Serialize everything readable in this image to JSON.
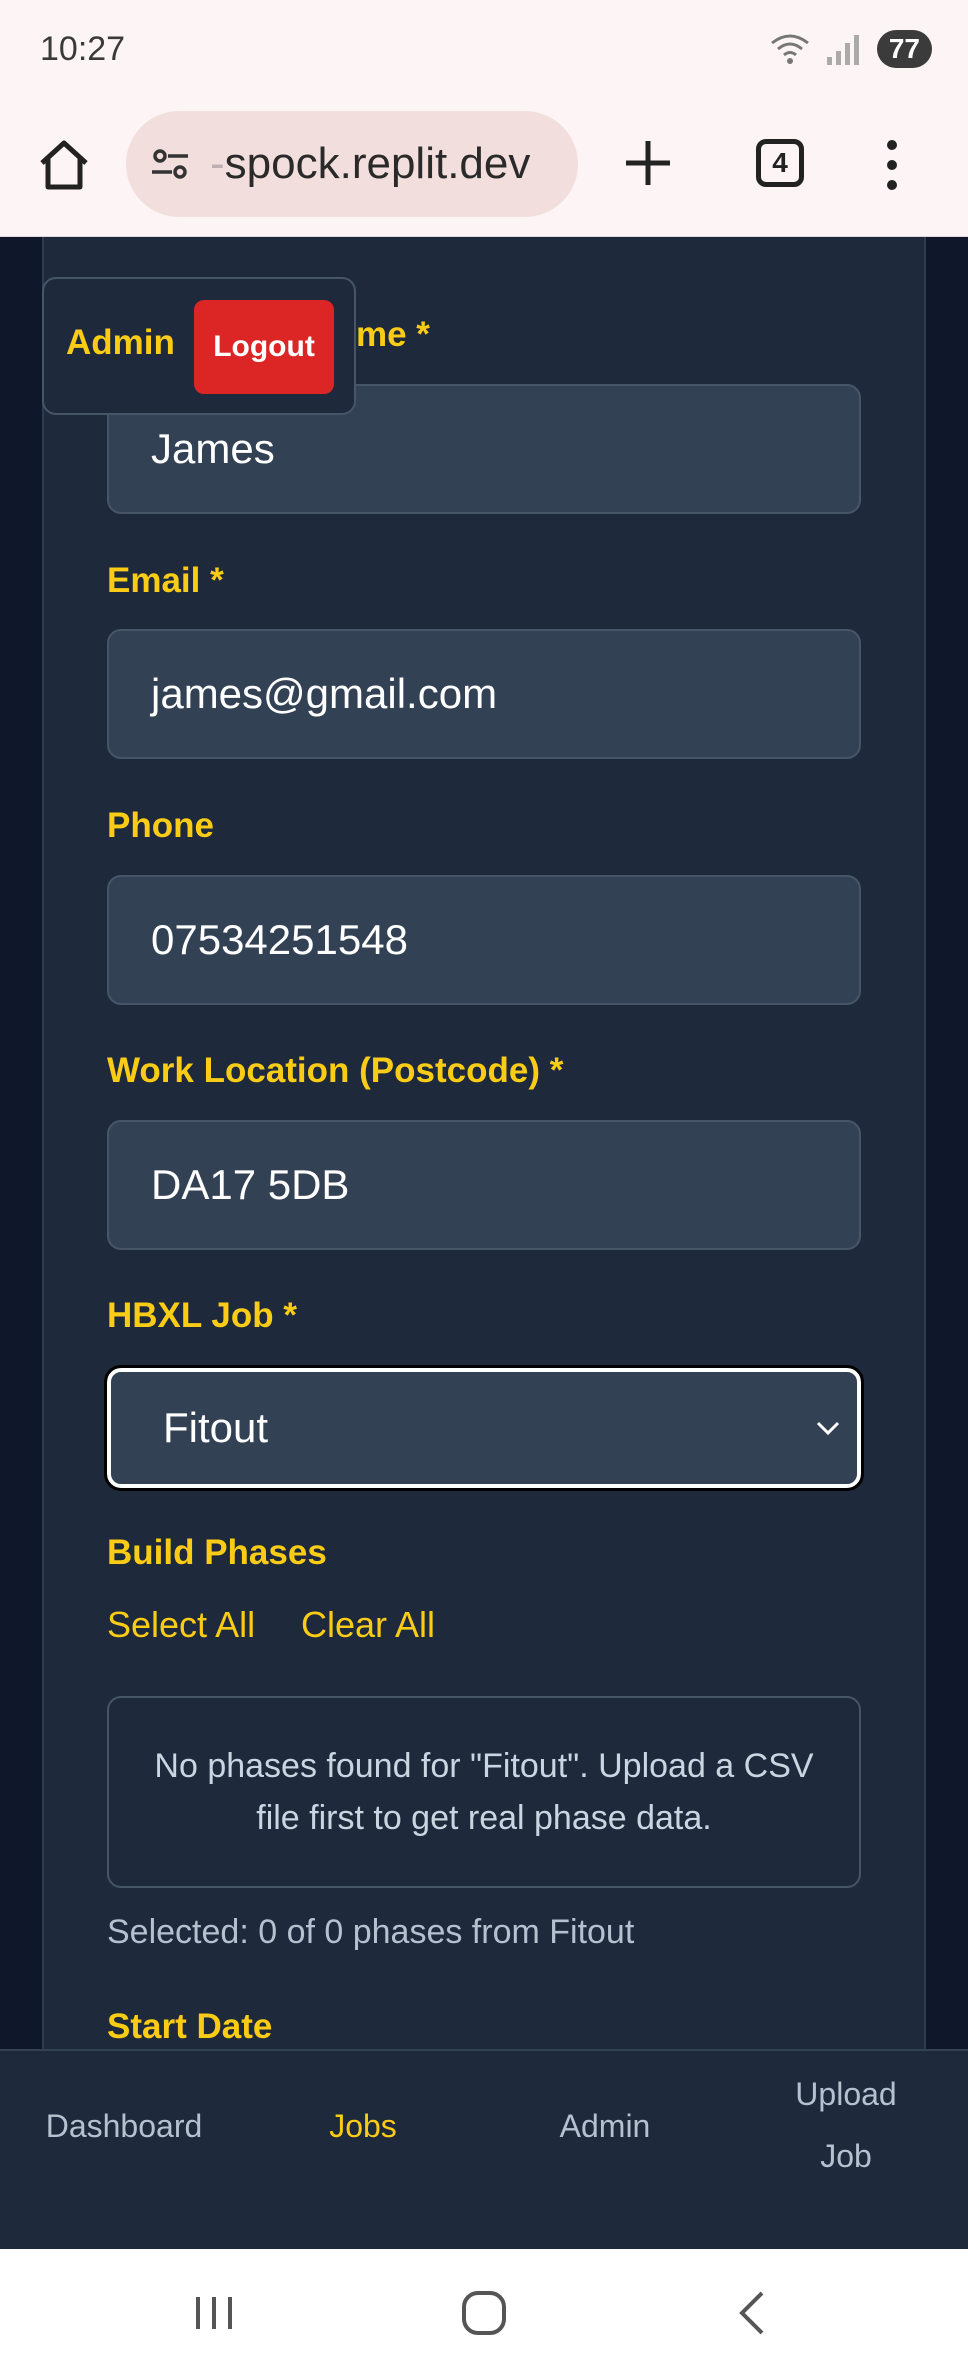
{
  "status_bar": {
    "time": "10:27",
    "battery": "77"
  },
  "browser": {
    "url_fade": "-",
    "url": "spock.replit.dev",
    "tab_count": "4"
  },
  "admin_overlay": {
    "label": "Admin",
    "logout_label": "Logout"
  },
  "form": {
    "name_label_visible": "me *",
    "name_value": "James",
    "email_label": "Email *",
    "email_value": "james@gmail.com",
    "phone_label": "Phone",
    "phone_value": "07534251548",
    "location_label": "Work Location (Postcode) *",
    "location_value": "DA17 5DB",
    "job_label": "HBXL Job *",
    "job_value": "Fitout",
    "phases_label": "Build Phases",
    "select_all": "Select All",
    "clear_all": "Clear All",
    "phases_message": "No phases found for \"Fitout\". Upload a CSV file first to get real phase data.",
    "selected_text": "Selected: 0 of 0 phases from Fitout",
    "start_date_label": "Start Date"
  },
  "bottom_nav": {
    "dashboard": "Dashboard",
    "jobs": "Jobs",
    "admin": "Admin",
    "upload_line1": "Upload",
    "upload_line2": "Job"
  },
  "colors": {
    "accent": "#facc15",
    "card_bg": "#1e293b",
    "input_bg": "#334155",
    "danger": "#dc2626"
  }
}
